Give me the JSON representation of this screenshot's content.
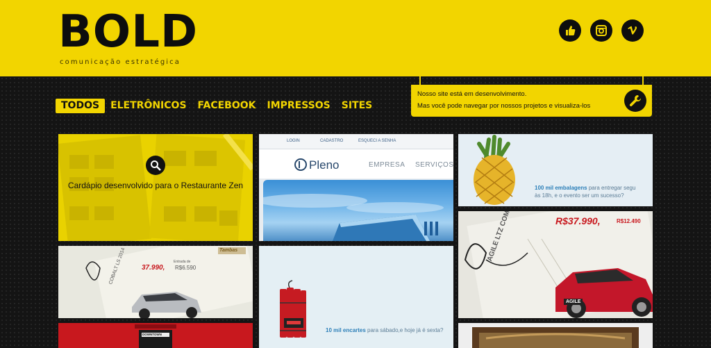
{
  "header": {
    "logo": "BOLD",
    "tagline": "comunicação estratégica",
    "social": [
      {
        "icon": "thumbs-up-icon",
        "label": "facebook"
      },
      {
        "icon": "instagram-icon",
        "label": "instagram"
      },
      {
        "icon": "vimeo-icon",
        "label": "vimeo"
      }
    ]
  },
  "nav": {
    "items": [
      "TODOS",
      "ELETRÔNICOS",
      "FACEBOOK",
      "IMPRESSOS",
      "SITES"
    ],
    "active": "TODOS"
  },
  "notice": {
    "line1": "Nosso site está em desenvolvimento.",
    "line2": "Mas você pode navegar por nossos projetos e visualiza-los"
  },
  "tiles": {
    "menu": {
      "caption": "Cardápio desenvolvido para o Restaurante Zen"
    },
    "pleno": {
      "login": "LOGIN",
      "cadastro": "CADASTRO",
      "esqueci": "ESQUECI A SENHA",
      "brand": "Pleno",
      "link1": "EMPRESA",
      "link2": "SERVIÇOS"
    },
    "pineapple": {
      "bold": "100 mil embalagens",
      "rest1": " para entregar segu",
      "line2": "às 18h, e o evento ser um sucesso?"
    },
    "agile": {
      "price": "R$37.990,",
      "price2": "R$12.490",
      "model": "AGILE LTZ COMPLETÍSSIMO",
      "plate": "AGILE"
    },
    "cobalt": {
      "brand": "Tambas",
      "price": "37.990,",
      "entrada": "Entrada de",
      "entrada_val": "R$6.590",
      "model": "COBALT LS 2014"
    },
    "dynamite": {
      "bold": "10 mil encartes",
      "rest": " para sábado,e hoje já é sexta?"
    },
    "bottom_red": {
      "label": "DOWNTOWN"
    }
  },
  "colors": {
    "brand_yellow": "#f2d500",
    "dark": "#111111"
  }
}
